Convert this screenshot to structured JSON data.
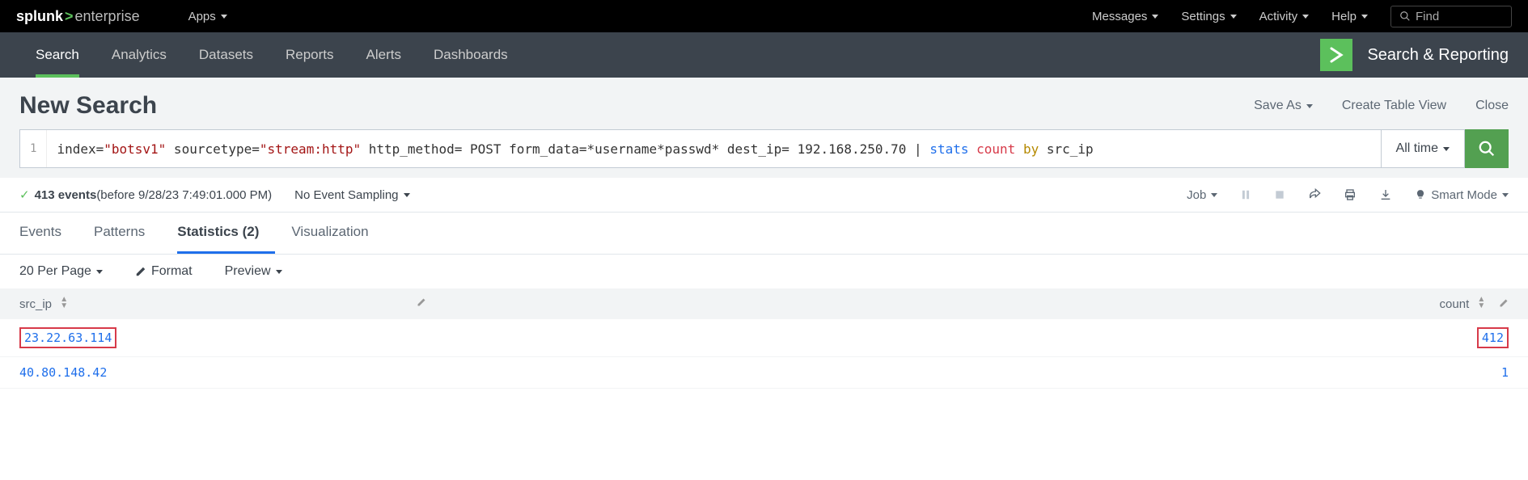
{
  "topbar": {
    "logo_splunk": "splunk",
    "logo_gt": ">",
    "logo_enterprise": "enterprise",
    "apps_label": "Apps",
    "messages": "Messages",
    "settings": "Settings",
    "activity": "Activity",
    "help": "Help",
    "find_placeholder": "Find"
  },
  "secondbar": {
    "search": "Search",
    "analytics": "Analytics",
    "datasets": "Datasets",
    "reports": "Reports",
    "alerts": "Alerts",
    "dashboards": "Dashboards",
    "app_title": "Search & Reporting"
  },
  "page": {
    "title": "New Search",
    "save_as": "Save As",
    "create_table": "Create Table View",
    "close": "Close"
  },
  "search": {
    "line_no": "1",
    "query_plain": "index=\"botsv1\" sourcetype=\"stream:http\" http_method= POST  form_data=*username*passwd* dest_ip= 192.168.250.70 | stats count by src_ip",
    "p_index": "index=",
    "p_botsv1": "\"botsv1\"",
    "p_sourcetype": " sourcetype=",
    "p_stream": "\"stream:http\"",
    "p_rest": " http_method= POST  form_data=*username*passwd* dest_ip= 192.168.250.70 | ",
    "p_stats": "stats",
    "p_count": "count",
    "p_by": "by",
    "p_src": " src_ip",
    "time_picker": "All time"
  },
  "status": {
    "events_count": "413 events",
    "before_time": " (before 9/28/23 7:49:01.000 PM)",
    "sampling": "No Event Sampling",
    "job": "Job",
    "smart_mode": "Smart Mode"
  },
  "tabs": {
    "events": "Events",
    "patterns": "Patterns",
    "statistics": "Statistics (2)",
    "visualization": "Visualization"
  },
  "controls": {
    "per_page": "20 Per Page",
    "format": "Format",
    "preview": "Preview"
  },
  "table": {
    "col_src_ip": "src_ip",
    "col_count": "count",
    "rows": [
      {
        "src_ip": "23.22.63.114",
        "count": "412",
        "highlight": true
      },
      {
        "src_ip": "40.80.148.42",
        "count": "1",
        "highlight": false
      }
    ]
  }
}
